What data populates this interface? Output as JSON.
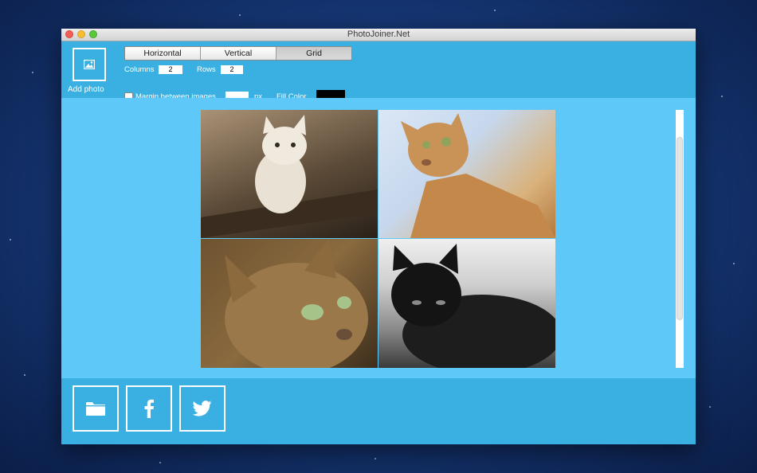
{
  "window": {
    "title": "PhotoJoiner.Net"
  },
  "toolbar": {
    "add_photo_label": "Add photo",
    "layout_tabs": [
      "Horizontal",
      "Vertical",
      "Grid"
    ],
    "selected_layout": "Grid",
    "columns_label": "Columns",
    "columns_value": "2",
    "rows_label": "Rows",
    "rows_value": "2",
    "margin_label": "Margin between images",
    "margin_checked": false,
    "margin_value": "",
    "margin_unit": "px",
    "fill_color_label": "Fill Color",
    "fill_color": "#000000"
  },
  "preview": {
    "images": [
      "white-kitten-on-branch",
      "bengal-cat-profile",
      "tabby-cat-closeup",
      "black-cat-lying"
    ]
  },
  "share_buttons": [
    "folder-icon",
    "facebook-icon",
    "twitter-icon"
  ],
  "colors": {
    "accent": "#3ab0e2",
    "canvas": "#5ec9f8"
  }
}
